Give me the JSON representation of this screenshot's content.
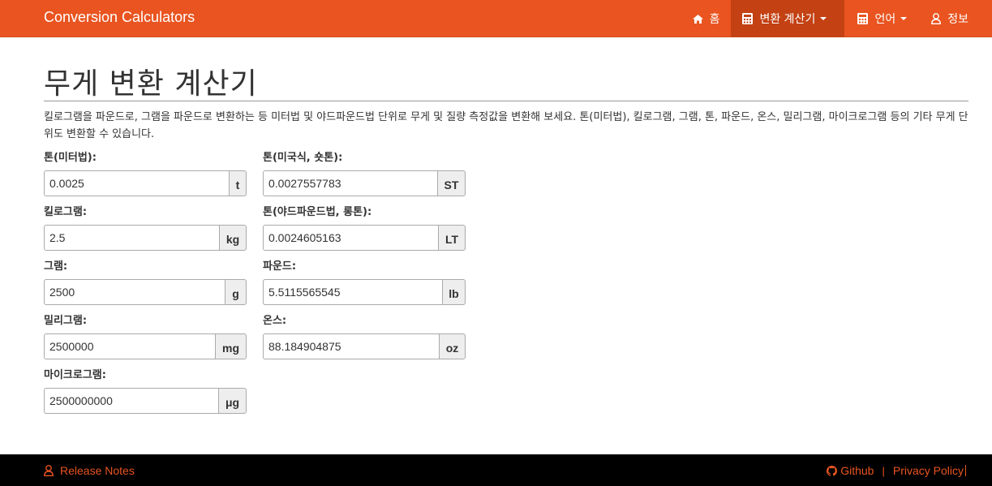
{
  "navbar": {
    "brand": "Conversion Calculators",
    "items": [
      {
        "label": "홈",
        "icon": "home-icon"
      },
      {
        "label": "변환 계산기",
        "icon": "calculator-icon",
        "dropdown": true,
        "active": true
      },
      {
        "label": "언어",
        "icon": "calculator-icon",
        "dropdown": true
      },
      {
        "label": "정보",
        "icon": "user-icon"
      }
    ]
  },
  "page": {
    "title": "무게 변환 계산기",
    "description": "킬로그램을 파운드로, 그램을 파운드로 변환하는 등 미터법 및 야드파운드법 단위로 무게 및 질량 측정값을 변환해 보세요. 톤(미터법), 킬로그램, 그램, 톤, 파운드, 온스, 밀리그램, 마이크로그램 등의 기타 무게 단위도 변환할 수 있습니다."
  },
  "fields": {
    "tonne": {
      "label": "톤(미터법):",
      "value": "0.0025",
      "unit": "t"
    },
    "kilogram": {
      "label": "킬로그램:",
      "value": "2.5",
      "unit": "kg"
    },
    "gram": {
      "label": "그램:",
      "value": "2500",
      "unit": "g"
    },
    "milligram": {
      "label": "밀리그램:",
      "value": "2500000",
      "unit": "mg"
    },
    "microgram": {
      "label": "마이크로그램:",
      "value": "2500000000",
      "unit": "μg"
    },
    "short_ton": {
      "label": "톤(미국식, 숏톤):",
      "value": "0.0027557783",
      "unit": "ST"
    },
    "long_ton": {
      "label": "톤(야드파운드법, 롱톤):",
      "value": "0.0024605163",
      "unit": "LT"
    },
    "pound": {
      "label": "파운드:",
      "value": "5.5115565545",
      "unit": "lb"
    },
    "ounce": {
      "label": "온스:",
      "value": "88.184904875",
      "unit": "oz"
    }
  },
  "footer": {
    "release_notes": "Release Notes",
    "github": "Github",
    "separator": "|",
    "privacy": "Privacy Policy"
  },
  "colors": {
    "accent": "#e95420",
    "nav_active": "#c34113",
    "footer_bg": "#000000"
  }
}
